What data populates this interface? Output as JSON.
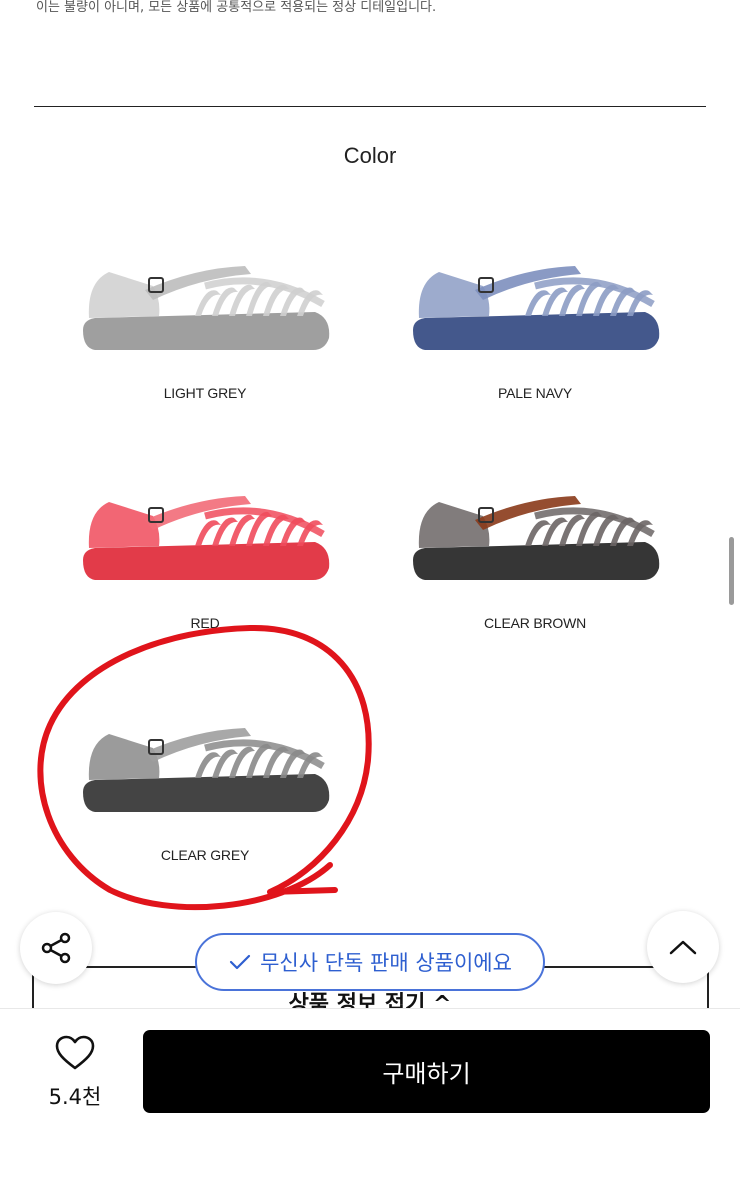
{
  "top_note": "이는 불량이 아니며, 모든 상품에 공통적으로 적용되는 정상 디테일입니다.",
  "section_title": "Color",
  "colors": [
    {
      "label": "LIGHT GREY",
      "body": "#cfcfcf",
      "sole": "#9a9a9a",
      "strap": "#bdbdbd"
    },
    {
      "label": "PALE NAVY",
      "body": "#8c9cc4",
      "sole": "#3a4f86",
      "strap": "#7d8fbe"
    },
    {
      "label": "RED",
      "body": "#f04b5c",
      "sole": "#e0303f",
      "strap": "#f26b78"
    },
    {
      "label": "CLEAR BROWN",
      "body": "#6b6565",
      "sole": "#2b2b2b",
      "strap": "#8a3a1a"
    },
    {
      "label": "CLEAR GREY",
      "body": "#8a8a8a",
      "sole": "#3a3a3a",
      "strap": "#9e9e9e"
    }
  ],
  "highlight_color": "#e0141b",
  "exclusive_badge": "무신사 단독 판매 상품이에요",
  "fold_label": "상품 정보 접기 ^",
  "like_count": "5.4천",
  "buy_label": "구매하기",
  "accent_color": "#2e5fd0",
  "icons": {
    "share": "share-icon",
    "top": "chevron-up-icon",
    "heart": "heart-icon",
    "check": "check-icon"
  }
}
